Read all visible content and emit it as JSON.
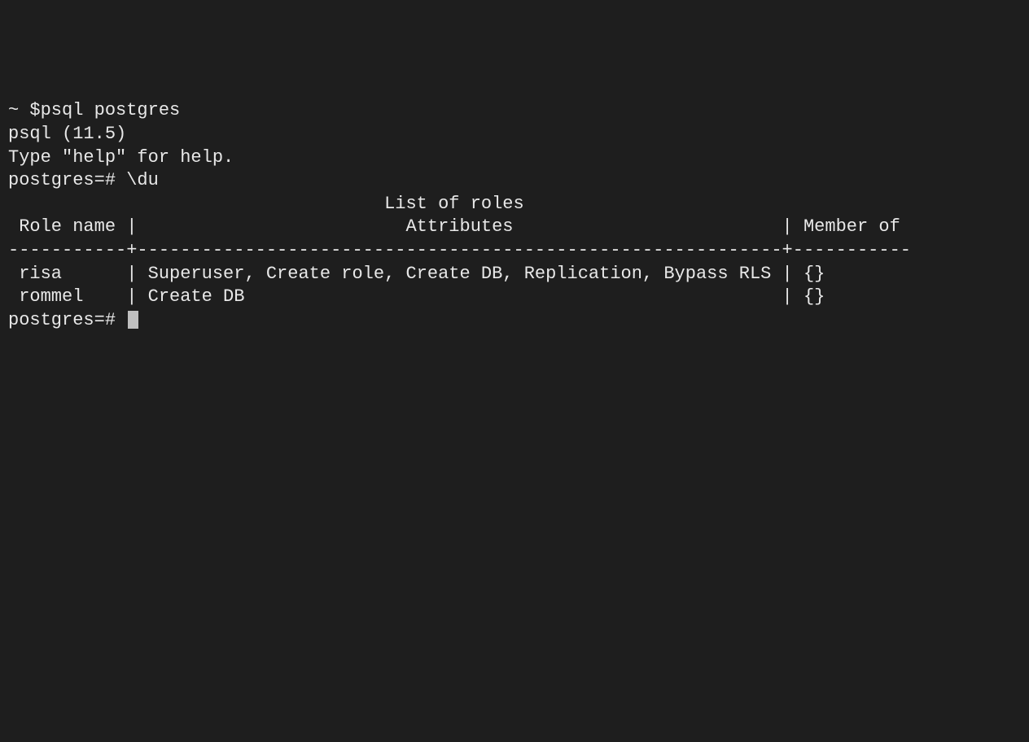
{
  "shell_prompt_line": "~ $psql postgres",
  "psql_version_line": "psql (11.5)",
  "help_line": "Type \"help\" for help.",
  "blank_line": "",
  "command_line": "postgres=# \\du",
  "table": {
    "title_line": "                                   List of roles",
    "header_line": " Role name |                         Attributes                         | Member of ",
    "separator_line": "-----------+------------------------------------------------------------+-----------",
    "rows": [
      " risa      | Superuser, Create role, Create DB, Replication, Bypass RLS | {}",
      " rommel    | Create DB                                                  | {}"
    ]
  },
  "prompt_end": "postgres=# "
}
